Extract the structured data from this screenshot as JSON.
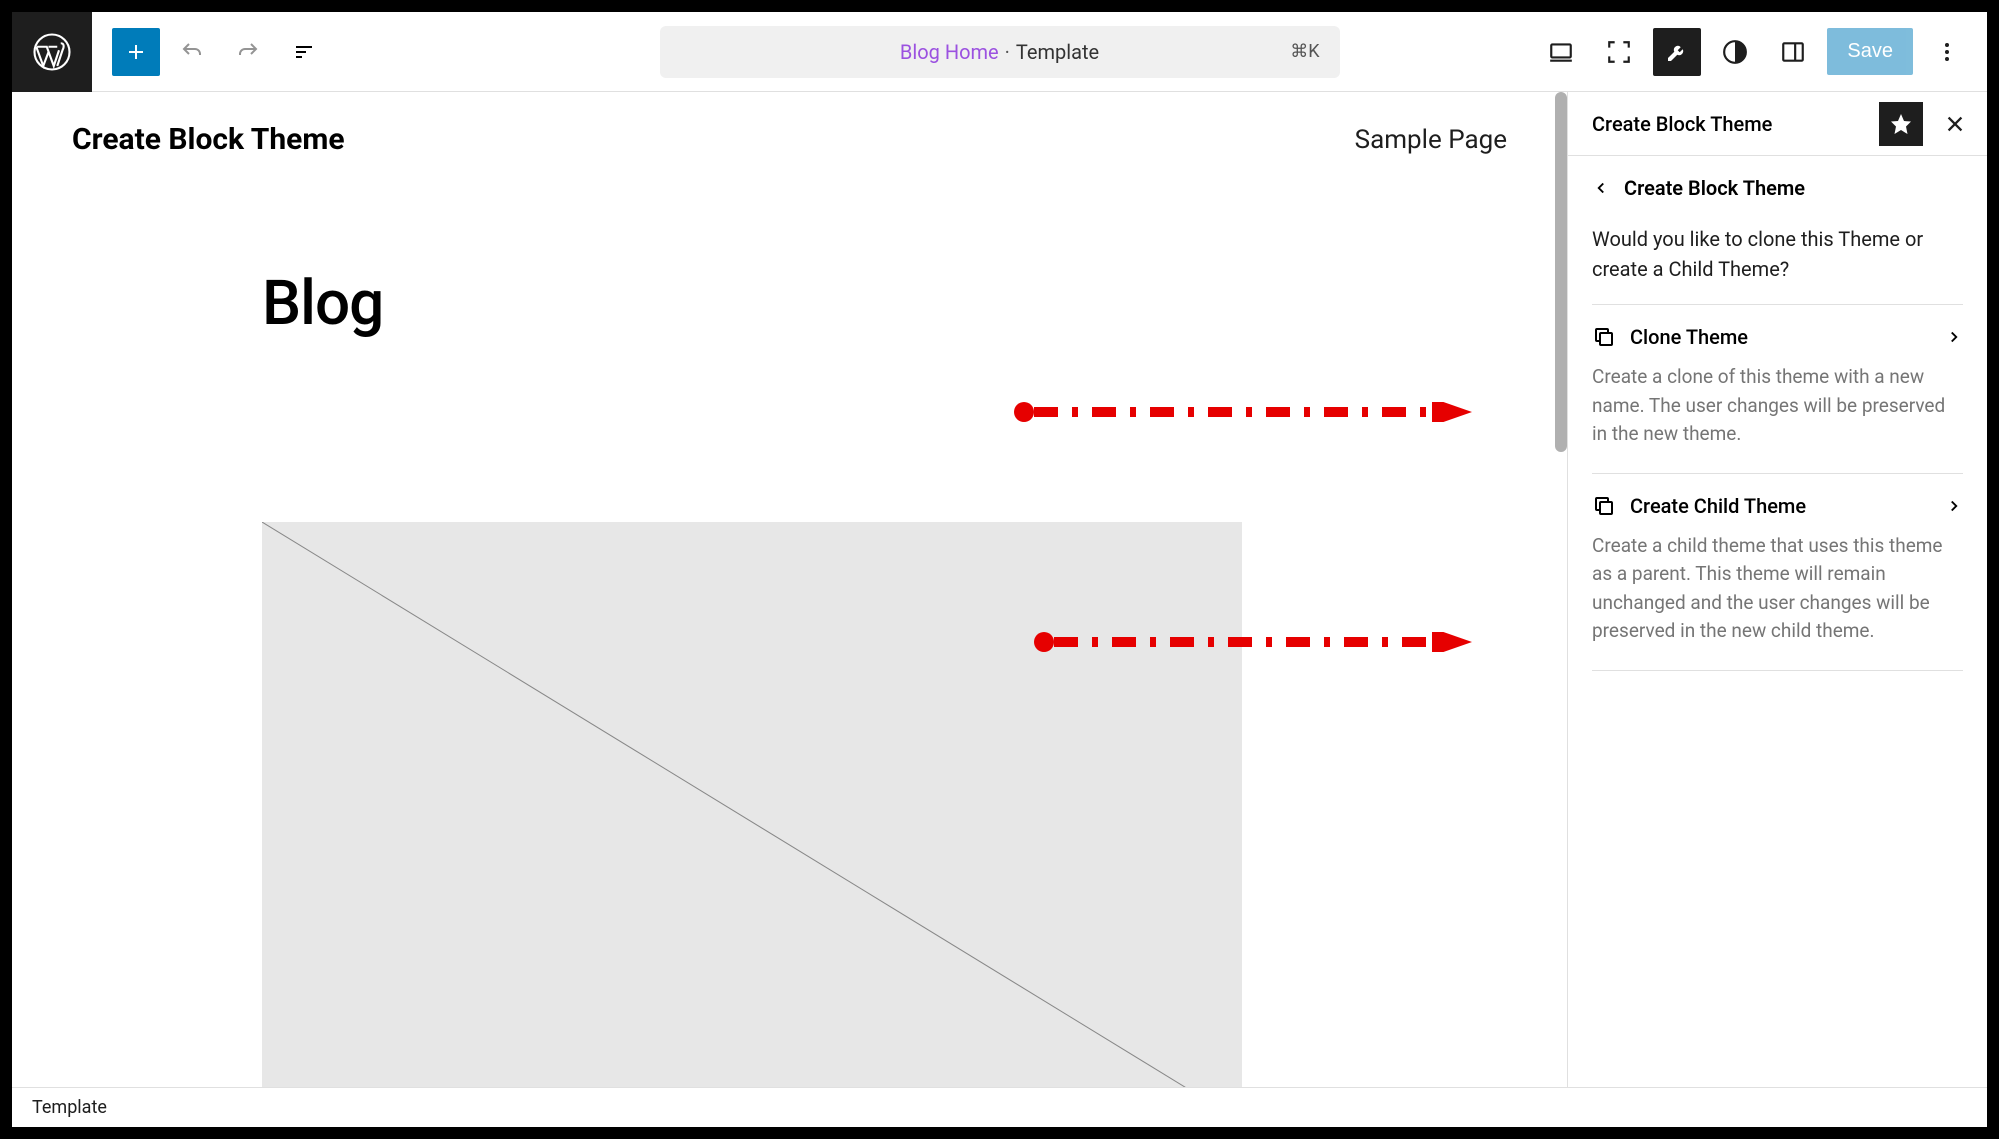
{
  "header": {
    "command_center_link": "Blog Home",
    "command_center_separator": "·",
    "command_center_text": "Template",
    "command_center_shortcut": "⌘K",
    "save_label": "Save"
  },
  "canvas": {
    "site_title": "Create Block Theme",
    "nav_link": "Sample Page",
    "heading": "Blog"
  },
  "sidebar": {
    "title": "Create Block Theme",
    "breadcrumb": "Create Block Theme",
    "prompt": "Would you like to clone this Theme or create a Child Theme?",
    "options": [
      {
        "label": "Clone Theme",
        "desc": "Create a clone of this theme with a new name. The user changes will be preserved in the new theme."
      },
      {
        "label": "Create Child Theme",
        "desc": "Create a child theme that uses this theme as a parent. This theme will remain unchanged and the user changes will be preserved in the new child theme."
      }
    ]
  },
  "footer": {
    "breadcrumb": "Template"
  }
}
